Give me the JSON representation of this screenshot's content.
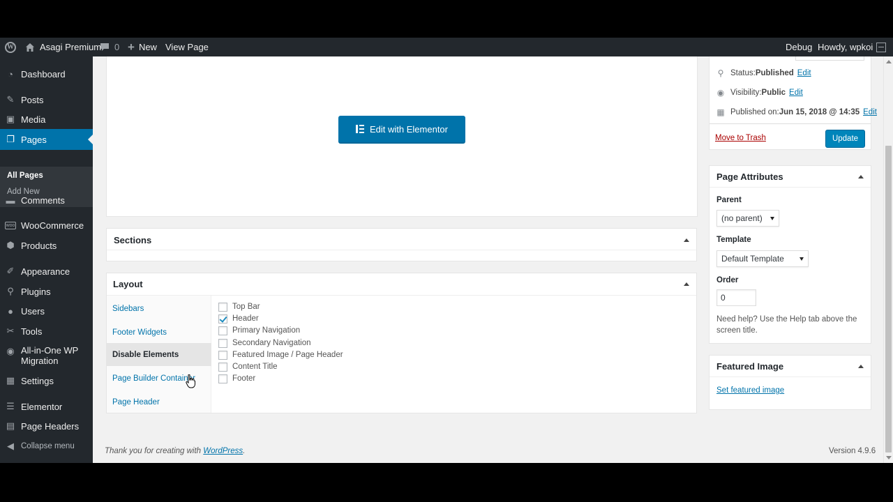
{
  "admin_bar": {
    "site_name": "Asagi Premium",
    "comments_count": "0",
    "new_label": "New",
    "view_page_label": "View Page",
    "debug_label": "Debug",
    "greeting": "Howdy, wpkoi"
  },
  "sidebar": {
    "items": [
      {
        "label": "Dashboard",
        "icon": "dashboard-icon"
      },
      {
        "label": "Posts",
        "icon": "pin-icon"
      },
      {
        "label": "Media",
        "icon": "media-icon"
      },
      {
        "label": "Pages",
        "icon": "pages-icon"
      },
      {
        "label": "Comments",
        "icon": "comments-icon"
      },
      {
        "label": "WooCommerce",
        "icon": "woocommerce-icon"
      },
      {
        "label": "Products",
        "icon": "products-icon"
      },
      {
        "label": "Appearance",
        "icon": "appearance-icon"
      },
      {
        "label": "Plugins",
        "icon": "plugins-icon"
      },
      {
        "label": "Users",
        "icon": "users-icon"
      },
      {
        "label": "Tools",
        "icon": "tools-icon"
      },
      {
        "label": "All-in-One WP Migration",
        "icon": "migration-icon"
      },
      {
        "label": "Settings",
        "icon": "settings-icon"
      },
      {
        "label": "Elementor",
        "icon": "elementor-icon"
      },
      {
        "label": "Page Headers",
        "icon": "page-headers-icon"
      },
      {
        "label": "Collapse menu",
        "icon": "collapse-icon"
      }
    ],
    "submenu": {
      "all_pages": "All Pages",
      "add_new": "Add New"
    }
  },
  "editor": {
    "edit_with_elementor": "Edit with Elementor"
  },
  "sections_box": {
    "title": "Sections"
  },
  "layout_box": {
    "title": "Layout",
    "tabs": [
      "Sidebars",
      "Footer Widgets",
      "Disable Elements",
      "Page Builder Container",
      "Page Header"
    ],
    "active_tab": "Disable Elements",
    "options": [
      {
        "label": "Top Bar",
        "checked": false
      },
      {
        "label": "Header",
        "checked": true
      },
      {
        "label": "Primary Navigation",
        "checked": false
      },
      {
        "label": "Secondary Navigation",
        "checked": false
      },
      {
        "label": "Featured Image / Page Header",
        "checked": false
      },
      {
        "label": "Content Title",
        "checked": false
      },
      {
        "label": "Footer",
        "checked": false
      }
    ]
  },
  "publish_box": {
    "status_label": "Status: ",
    "status_value": "Published",
    "visibility_label": "Visibility: ",
    "visibility_value": "Public",
    "published_label": "Published on: ",
    "published_value": "Jun 15, 2018 @ 14:35",
    "edit_label": "Edit",
    "trash_label": "Move to Trash",
    "update_label": "Update"
  },
  "page_attributes": {
    "title": "Page Attributes",
    "parent_label": "Parent",
    "parent_value": "(no parent)",
    "template_label": "Template",
    "template_value": "Default Template",
    "order_label": "Order",
    "order_value": "0",
    "help_text": "Need help? Use the Help tab above the screen title."
  },
  "featured_image": {
    "title": "Featured Image",
    "link": "Set featured image"
  },
  "footer": {
    "thanks_prefix": "Thank you for creating with ",
    "wordpress_link": "WordPress",
    "thanks_suffix": ".",
    "version": "Version 4.9.6"
  },
  "colors": {
    "primary": "#0073aa",
    "adminbar": "#23282d",
    "trash": "#a00000"
  }
}
